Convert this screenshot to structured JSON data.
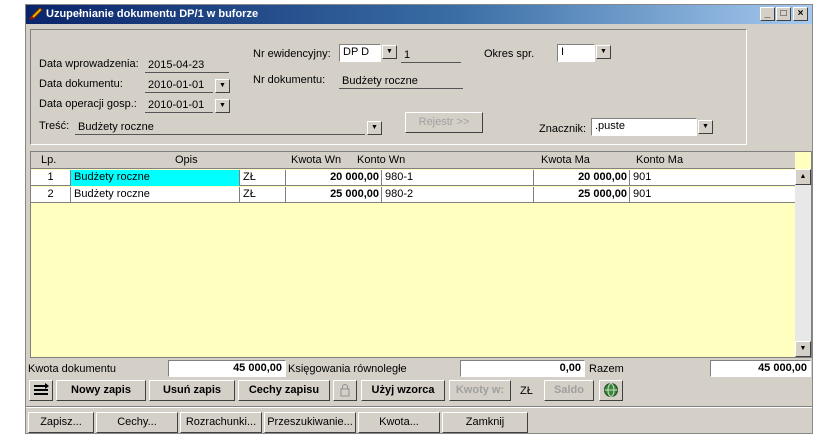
{
  "window": {
    "title": "Uzupełnianie dokumentu DP/1 w buforze",
    "controls": {
      "minimize": "_",
      "maximize": "□",
      "close": "×"
    }
  },
  "header": {
    "data_wprowadzenia_label": "Data wprowadzenia:",
    "data_wprowadzenia": "2015-04-23",
    "data_dokumentu_label": "Data dokumentu:",
    "data_dokumentu": "2010-01-01",
    "data_operacji_label": "Data operacji gosp.:",
    "data_operacji": "2010-01-01",
    "tresc_label": "Treść:",
    "tresc": "Budżety roczne",
    "nr_ewidencyjny_label": "Nr ewidencyjny:",
    "nr_ewidencyjny_type": "DP  D",
    "nr_ewidencyjny_num": "1",
    "nr_dokumentu_label": "Nr dokumentu:",
    "nr_dokumentu": "Budżety roczne",
    "okres_label": "Okres spr.",
    "okres": "I",
    "rejestr_button": "Rejestr >>",
    "znacznik_label": "Znacznik:",
    "znacznik": ".puste"
  },
  "table": {
    "columns": [
      "Lp.",
      "Opis",
      "Kwota Wn",
      "Konto Wn",
      "Kwota Ma",
      "Konto Ma"
    ],
    "rows": [
      {
        "lp": "1",
        "opis": "Budżety roczne",
        "waluta": "ZŁ",
        "kwota_wn": "20 000,00",
        "konto_wn": "980-1",
        "kwota_ma": "20 000,00",
        "konto_ma": "901"
      },
      {
        "lp": "2",
        "opis": "Budżety roczne",
        "waluta": "ZŁ",
        "kwota_wn": "25 000,00",
        "konto_wn": "980-2",
        "kwota_ma": "25 000,00",
        "konto_ma": "901"
      }
    ]
  },
  "summary": {
    "kwota_dokumentu_label": "Kwota dokumentu",
    "kwota_dokumentu": "45 000,00",
    "ksiegowania_label": "Księgowania równoległe",
    "ksiegowania": "0,00",
    "razem_label": "Razem",
    "razem": "45 000,00"
  },
  "toolbar": {
    "nowy_zapis": "Nowy zapis",
    "usun_zapis": "Usuń zapis",
    "cechy_zapisu": "Cechy zapisu",
    "uzyj_wzorca": "Użyj wzorca",
    "kwoty_w": "Kwoty w:",
    "waluta": "ZŁ",
    "saldo": "Saldo"
  },
  "bottom_buttons": {
    "zapisz": "Zapisz...",
    "cechy": "Cechy...",
    "rozrachunki": "Rozrachunki...",
    "przeszukiwanie": "Przeszukiwanie...",
    "kwota": "Kwota...",
    "zamknij": "Zamknij"
  },
  "colors": {
    "title_bar": "#0a246a",
    "grid_background": "#ffffc0",
    "selected_cell": "#00ffff",
    "window_face": "#d4d0c8"
  },
  "icons": [
    "pencil-icon",
    "menu-lines-icon",
    "lock-icon",
    "globe-icon"
  ]
}
